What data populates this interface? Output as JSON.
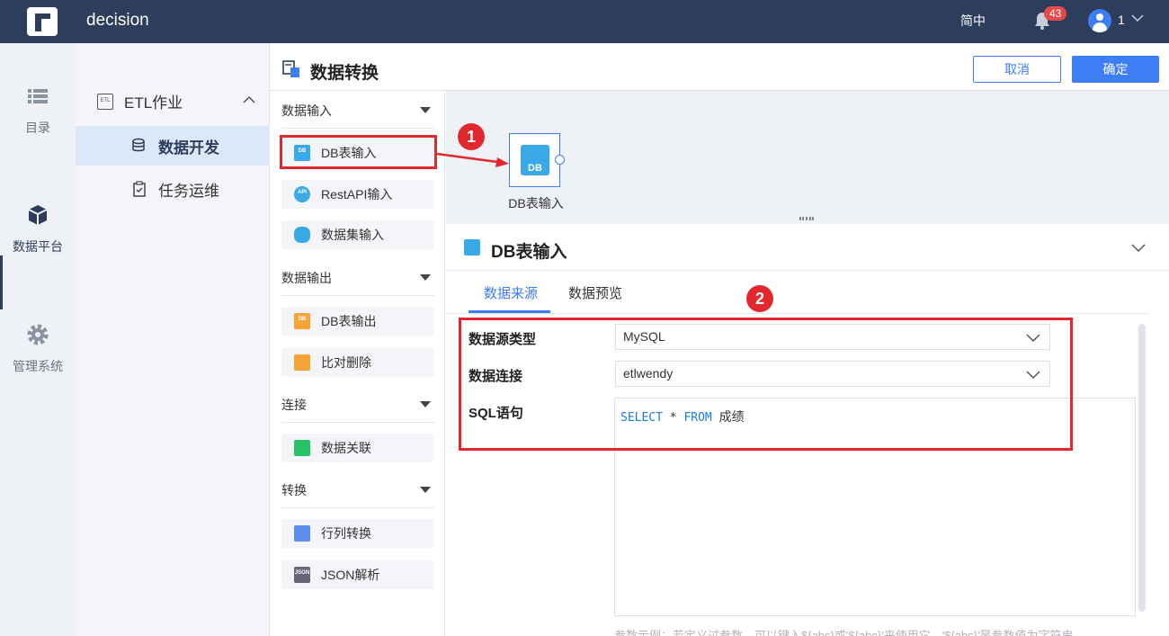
{
  "topbar": {
    "app_name": "decision",
    "language": "简中",
    "notification_count": "43",
    "user_name": "1"
  },
  "rail": {
    "items": [
      {
        "label": "目录",
        "icon": "list-icon"
      },
      {
        "label": "数据平台",
        "icon": "cube-icon",
        "active": true
      },
      {
        "label": "管理系统",
        "icon": "gear-icon"
      }
    ]
  },
  "nav": {
    "group": "ETL作业",
    "group_icon_text": "ETL",
    "items": [
      {
        "label": "数据开发",
        "active": true
      },
      {
        "label": "任务运维"
      }
    ]
  },
  "page": {
    "title": "数据转换",
    "cancel_label": "取消",
    "ok_label": "确定"
  },
  "palette": {
    "categories": [
      {
        "label": "数据输入",
        "items": [
          "DB表输入",
          "RestAPI输入",
          "数据集输入"
        ]
      },
      {
        "label": "数据输出",
        "items": [
          "DB表输出",
          "比对删除"
        ]
      },
      {
        "label": "连接",
        "items": [
          "数据关联"
        ]
      },
      {
        "label": "转换",
        "items": [
          "行列转换",
          "JSON解析"
        ]
      }
    ],
    "icon_texts": {
      "db": "DB",
      "api": "API",
      "json": "JSON"
    }
  },
  "canvas": {
    "node_label": "DB表输入",
    "node_icon_text": "DB"
  },
  "detail": {
    "title": "DB表输入",
    "tabs": [
      "数据来源",
      "数据预览"
    ],
    "active_tab": "数据来源",
    "fields": {
      "datasource_type_label": "数据源类型",
      "datasource_type_value": "MySQL",
      "connection_label": "数据连接",
      "connection_value": "etlwendy",
      "sql_label": "SQL语句",
      "sql_keyword_select": "SELECT",
      "sql_star": "*",
      "sql_keyword_from": "FROM",
      "sql_table": "成绩"
    },
    "hint": "参数示例：若定义过参数，可以键入${abc}或'${abc}'来使用它，'${abc}'是参数值为字符串"
  },
  "annotations": {
    "one": "1",
    "two": "2"
  },
  "colors": {
    "topbar": "#2c3e5c",
    "accent": "#3d7ef5",
    "annotation": "#e0282e"
  }
}
